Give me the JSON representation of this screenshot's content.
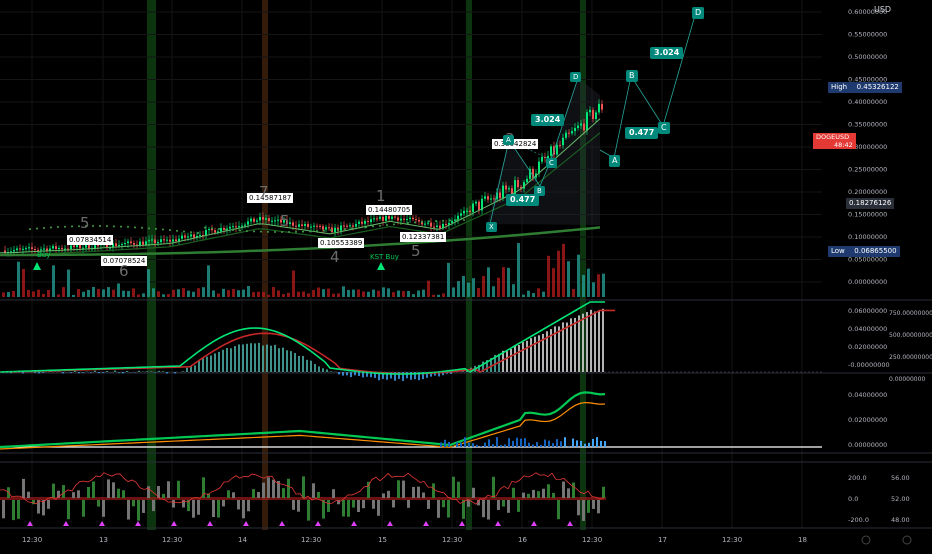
{
  "currency": "USD",
  "symbol_tag": "DOGEUSD",
  "symbol_countdown": "48:42",
  "high_label": "High",
  "high_value": "0.45326122",
  "low_label": "Low",
  "low_value": "0.06865500",
  "mid_value": "0.18276126",
  "colors": {
    "up": "#26a69a",
    "down": "#ef5350",
    "bright_green": "#00e676",
    "accent_teal": "#009688",
    "signal_red": "#e53935",
    "axis_text": "#b2b5be"
  },
  "price_axis": {
    "ticks": [
      "0.60000000",
      "0.55000000",
      "0.50000000",
      "0.45000000",
      "0.40000000",
      "0.35000000",
      "0.30000000",
      "0.25000000",
      "0.20000000",
      "0.15000000",
      "0.10000000",
      "0.05000000",
      "0.00000000"
    ]
  },
  "macd_axis": {
    "left_ticks": [
      "0.06000000",
      "0.04000000",
      "0.02000000",
      "-0.00000000"
    ],
    "right_ticks": [
      "750.00000000",
      "500.00000000",
      "250.00000000",
      "0.00000000"
    ]
  },
  "osc_axis": {
    "ticks": [
      "0.04000000",
      "0.02000000",
      "0.00000000"
    ]
  },
  "rsi_axis": {
    "left_ticks": [
      "200.0",
      "0.0",
      "-200.0"
    ],
    "right_ticks": [
      "56.00",
      "52.00",
      "48.00"
    ]
  },
  "time_axis": {
    "ticks": [
      "12:30",
      "13",
      "12:30",
      "14",
      "12:30",
      "15",
      "12:30",
      "16",
      "12:30",
      "17",
      "12:30",
      "18"
    ]
  },
  "price_labels": [
    "0.07834514",
    "0.07078524",
    "0.14587187",
    "0.10553389",
    "0.14480705",
    "0.12337381",
    "0.30042824"
  ],
  "wave_numbers": [
    "5",
    "6",
    "7",
    "5",
    "4",
    "1",
    "5",
    "3"
  ],
  "signal_text": [
    "KST Buy",
    "Buy"
  ],
  "harmonic": {
    "points": [
      "X",
      "A",
      "B",
      "C",
      "D"
    ],
    "ratios": [
      "3.024",
      "0.477"
    ],
    "projection_points": [
      "A",
      "B",
      "C",
      "D"
    ],
    "projection_ratios": [
      "0.477",
      "3.024"
    ]
  },
  "chart_data": {
    "type": "candlestick",
    "symbol": "DOGEUSD",
    "x": [
      "12:30",
      "13",
      "12:30",
      "14",
      "12:30",
      "15",
      "12:30",
      "16",
      "12:30"
    ],
    "close": [
      0.07,
      0.078,
      0.092,
      0.14,
      0.115,
      0.145,
      0.125,
      0.22,
      0.39
    ],
    "ylim": [
      0.0,
      0.62
    ],
    "high": 0.45326122,
    "low": 0.068655,
    "legend": "none",
    "grid": true
  }
}
